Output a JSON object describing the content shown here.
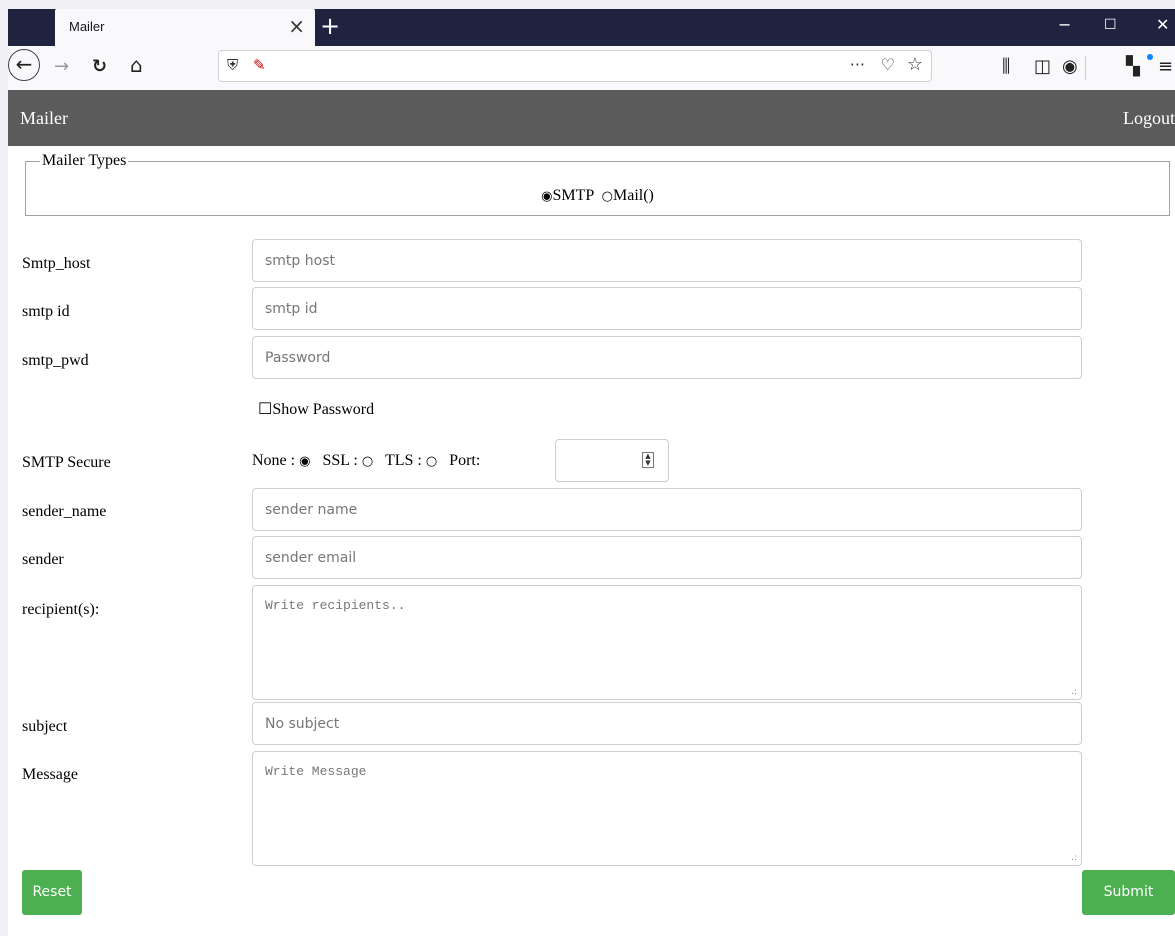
{
  "browser": {
    "tab_title": "Mailer",
    "tab_close": "×",
    "new_tab": "+",
    "window_minimize": "−",
    "window_maximize": "☐",
    "window_close": "✕",
    "url": "",
    "icons": {
      "back": "←",
      "forward": "→",
      "reload": "↻",
      "home": "⌂",
      "shield": "⛨",
      "insecure_lock": "✎",
      "more": "···",
      "pocket": "♡",
      "bookmark_star": "☆",
      "library": "⫼",
      "sidebar": "◫",
      "account": "◉",
      "extension": "▚",
      "menu": "≡"
    },
    "colors": {
      "titlebar": "#202340",
      "toolbar": "#f9f9fb"
    }
  },
  "nav": {
    "title": "Mailer",
    "logout": "Logout",
    "background": "#5b5b5b"
  },
  "mailer_types": {
    "legend": "Mailer Types",
    "options": [
      {
        "label": "SMTP",
        "selected": true,
        "glyph": "◉"
      },
      {
        "label": "Mail()",
        "selected": false,
        "glyph": "○"
      }
    ]
  },
  "form": {
    "smtp_host": {
      "label": "Smtp_host",
      "placeholder": "smtp host",
      "value": ""
    },
    "smtp_id": {
      "label": "smtp id",
      "placeholder": "smtp id",
      "value": ""
    },
    "smtp_pwd": {
      "label": "smtp_pwd",
      "placeholder": "Password",
      "value": ""
    },
    "show_password": {
      "label": "Show Password",
      "checked": false,
      "glyph": "☐"
    },
    "smtp_secure": {
      "label": "SMTP Secure",
      "options": [
        {
          "label": "None :",
          "selected": true,
          "glyph": "◉"
        },
        {
          "label": "SSL :",
          "selected": false,
          "glyph": "○"
        },
        {
          "label": "TLS :",
          "selected": false,
          "glyph": "○"
        }
      ],
      "port_label": "Port:",
      "port_value": ""
    },
    "sender_name": {
      "label": "sender_name",
      "placeholder": "sender name",
      "value": ""
    },
    "sender": {
      "label": "sender",
      "placeholder": "sender email",
      "value": ""
    },
    "recipients": {
      "label": "recipient(s):",
      "placeholder": "Write recipients..",
      "value": ""
    },
    "subject": {
      "label": "subject",
      "placeholder": "No subject",
      "value": ""
    },
    "message": {
      "label": "Message",
      "placeholder": "Write Message",
      "value": ""
    },
    "textarea_grip": ".:"
  },
  "buttons": {
    "reset": "Reset",
    "submit": "Submit",
    "color": "#4caf50"
  }
}
